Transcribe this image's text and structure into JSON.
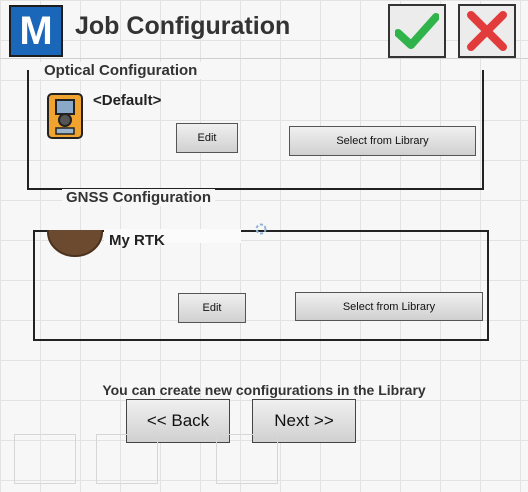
{
  "header": {
    "logo_letter": "M",
    "title": "Job Configuration",
    "ok_icon": "checkmark-icon",
    "cancel_icon": "close-icon",
    "colors": {
      "ok": "#2fb34a",
      "cancel": "#e23b3b",
      "brand": "#1a66b8"
    }
  },
  "optical": {
    "section_title": "Optical Configuration",
    "value": "<Default>",
    "edit_label": "Edit",
    "library_label": "Select from Library"
  },
  "gnss": {
    "section_title": "GNSS Configuration",
    "value": "My RTK",
    "edit_label": "Edit",
    "library_label": "Select from Library"
  },
  "footer": {
    "hint": "You can create new configurations in the Library",
    "back_label": "<< Back",
    "next_label": "Next >>"
  }
}
